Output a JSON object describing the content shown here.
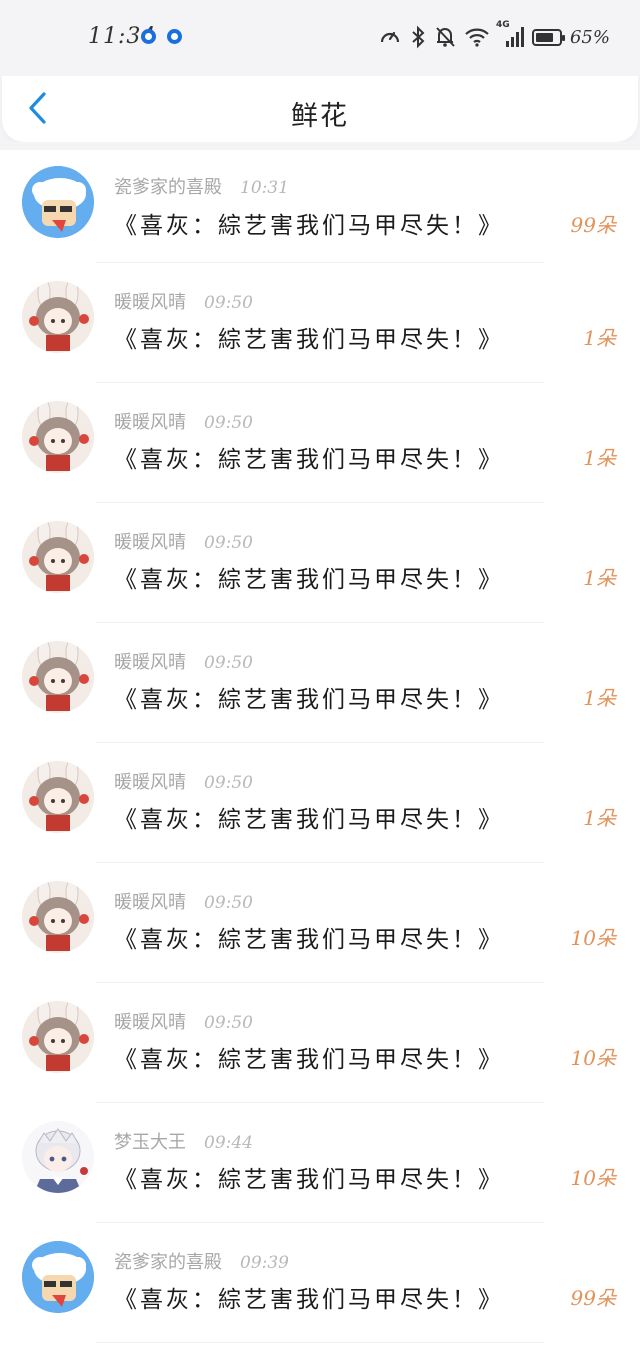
{
  "status_bar": {
    "time": "11:34",
    "battery_percent": "65%",
    "network_label": "4G",
    "battery_level": 0.65
  },
  "header": {
    "title": "鲜花",
    "back_icon": "chevron-left-icon"
  },
  "colors": {
    "accent_blue": "#1d8ce0",
    "amount_orange": "#e2935a",
    "muted_text": "#a8a8a8"
  },
  "items": [
    {
      "name": "瓷爹家的喜殿",
      "time": "10:31",
      "message": "《喜灰：綜艺害我们马甲尽失！》",
      "amount": "99朵",
      "avatar": "sheep"
    },
    {
      "name": "暖暖风晴",
      "time": "09:50",
      "message": "《喜灰：綜艺害我们马甲尽失！》",
      "amount": "1朵",
      "avatar": "bunny-girl"
    },
    {
      "name": "暖暖风晴",
      "time": "09:50",
      "message": "《喜灰：綜艺害我们马甲尽失！》",
      "amount": "1朵",
      "avatar": "bunny-girl"
    },
    {
      "name": "暖暖风晴",
      "time": "09:50",
      "message": "《喜灰：綜艺害我们马甲尽失！》",
      "amount": "1朵",
      "avatar": "bunny-girl"
    },
    {
      "name": "暖暖风晴",
      "time": "09:50",
      "message": "《喜灰：綜艺害我们马甲尽失！》",
      "amount": "1朵",
      "avatar": "bunny-girl"
    },
    {
      "name": "暖暖风晴",
      "time": "09:50",
      "message": "《喜灰：綜艺害我们马甲尽失！》",
      "amount": "1朵",
      "avatar": "bunny-girl"
    },
    {
      "name": "暖暖风晴",
      "time": "09:50",
      "message": "《喜灰：綜艺害我们马甲尽失！》",
      "amount": "10朵",
      "avatar": "bunny-girl"
    },
    {
      "name": "暖暖风晴",
      "time": "09:50",
      "message": "《喜灰：綜艺害我们马甲尽失！》",
      "amount": "10朵",
      "avatar": "bunny-girl"
    },
    {
      "name": "梦玉大王",
      "time": "09:44",
      "message": "《喜灰：綜艺害我们马甲尽失！》",
      "amount": "10朵",
      "avatar": "white-hair-boy"
    },
    {
      "name": "瓷爹家的喜殿",
      "time": "09:39",
      "message": "《喜灰：綜艺害我们马甲尽失！》",
      "amount": "99朵",
      "avatar": "sheep"
    }
  ]
}
